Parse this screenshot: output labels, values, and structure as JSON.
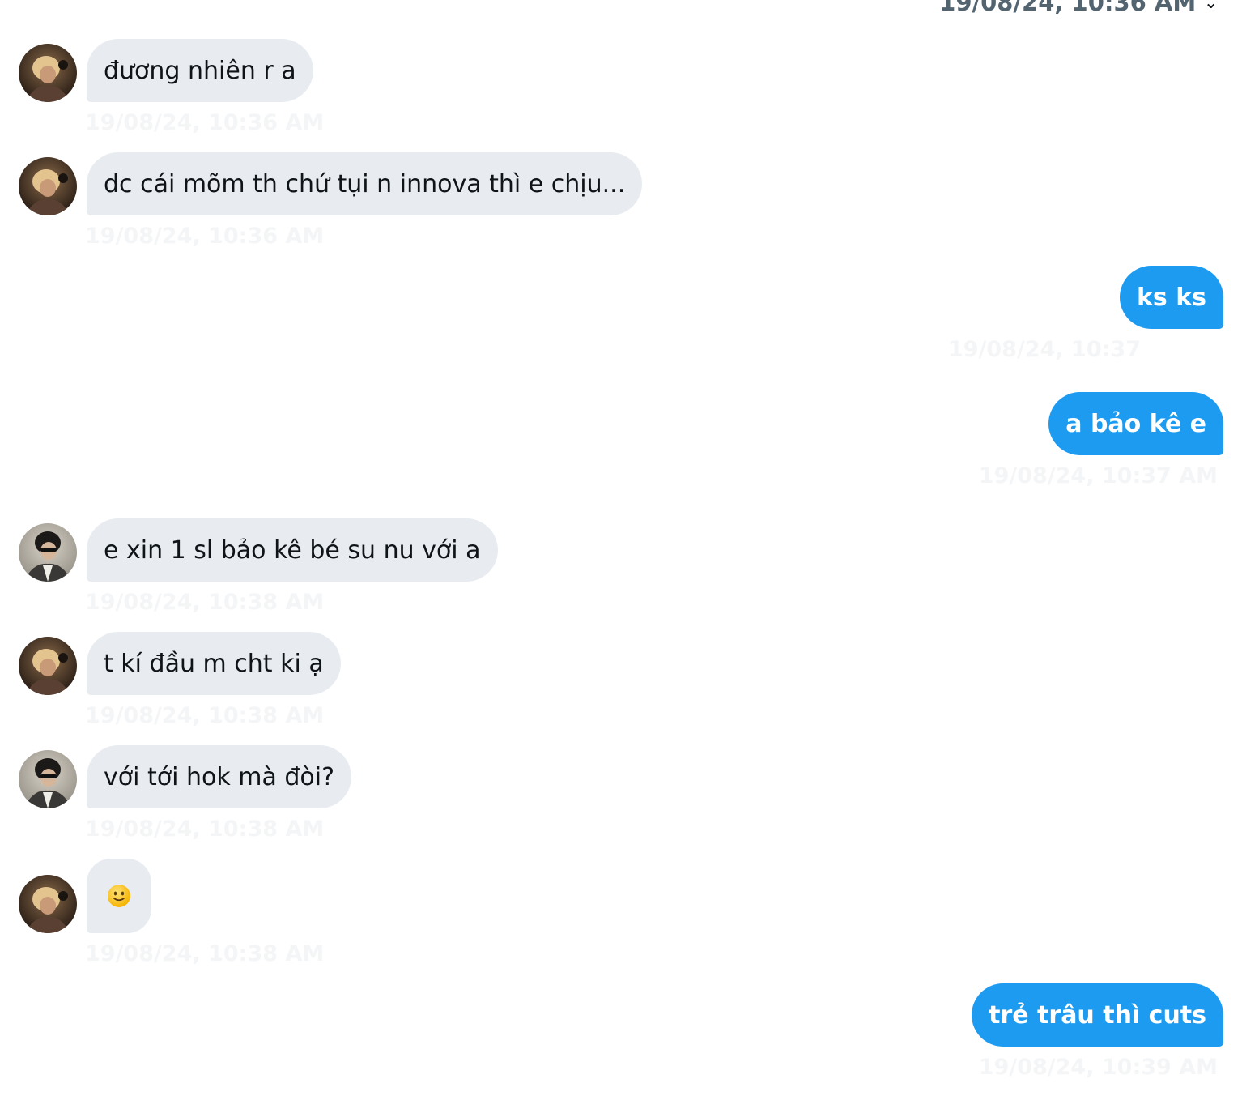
{
  "header": {
    "timestamp": "19/08/24, 10:36 AM",
    "check_icon": "chevron-check-icon"
  },
  "colors": {
    "incoming_bubble": "#e8ecf0",
    "outgoing_bubble": "#1d9bf0",
    "incoming_text": "#0f1419",
    "outgoing_text": "#ffffff"
  },
  "messages": [
    {
      "direction": "in",
      "avatar": "user-a-avatar",
      "text": "đương nhiên r a",
      "timestamp": "19/08/24, 10:36 AM"
    },
    {
      "direction": "in",
      "avatar": "user-a-avatar",
      "text": "dc cái mõm th chứ tụi n innova thì e chịu...",
      "timestamp": "19/08/24, 10:36 AM"
    },
    {
      "direction": "out",
      "text": "ks ks",
      "timestamp": "19/08/24, 10:37"
    },
    {
      "direction": "out",
      "text": "a bảo kê e",
      "timestamp": "19/08/24, 10:37 AM"
    },
    {
      "direction": "in",
      "avatar": "user-b-avatar",
      "text": "e xin 1 sl bảo kê bé su nu với a",
      "timestamp": "19/08/24, 10:38 AM"
    },
    {
      "direction": "in",
      "avatar": "user-a-avatar",
      "text": "t kí đầu m cht ki ạ",
      "timestamp": "19/08/24, 10:38 AM"
    },
    {
      "direction": "in",
      "avatar": "user-b-avatar",
      "text": "với tới hok mà đòi?",
      "timestamp": "19/08/24, 10:38 AM"
    },
    {
      "direction": "in",
      "avatar": "user-a-avatar",
      "text": "🙂",
      "emoji": "slightly-smiling-face-icon",
      "timestamp": "19/08/24, 10:38 AM"
    },
    {
      "direction": "out",
      "text": "trẻ trâu thì cuts",
      "timestamp": "19/08/24, 10:39 AM"
    }
  ]
}
